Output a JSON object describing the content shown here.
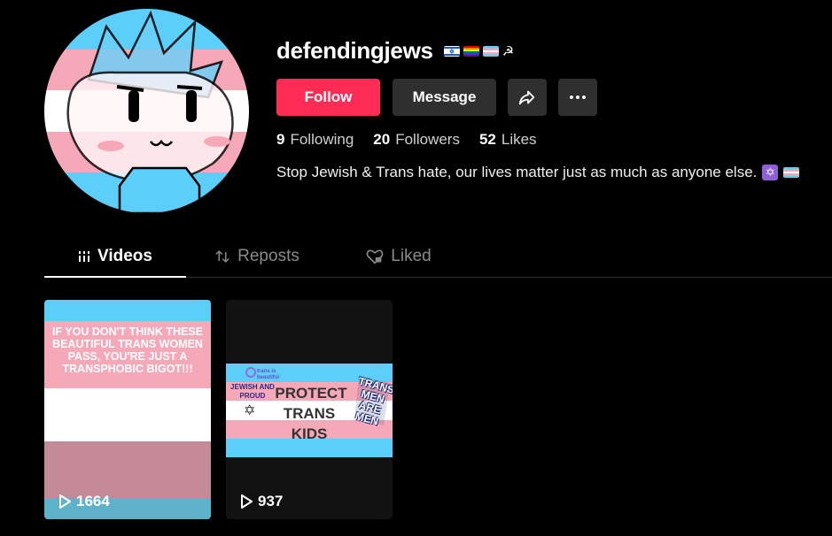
{
  "profile": {
    "username": "defendingjews",
    "flags": [
      "israel-flag-icon",
      "rainbow-flag-icon",
      "trans-flag-icon",
      "hammer-sickle-icon"
    ],
    "bio": "Stop Jewish & Trans hate, our lives matter just as much as anyone else.",
    "bio_icons": [
      "star-of-david-icon",
      "trans-flag-icon"
    ]
  },
  "actions": {
    "follow_label": "Follow",
    "message_label": "Message"
  },
  "stats": {
    "following_count": "9",
    "following_label": "Following",
    "followers_count": "20",
    "followers_label": "Followers",
    "likes_count": "52",
    "likes_label": "Likes"
  },
  "tabs": [
    {
      "label": "Videos",
      "active": true
    },
    {
      "label": "Reposts",
      "active": false
    },
    {
      "label": "Liked",
      "active": false
    }
  ],
  "videos": [
    {
      "overlay_text": "IF YOU DON'T THINK THESE BEAUTIFUL TRANS WOMEN PASS, YOU'RE JUST A TRANSPHOBIC BIGOT!!!",
      "views": "1664"
    },
    {
      "banner_text_1": "PROTECT",
      "banner_text_2": "TRANS",
      "banner_text_3": "KIDS",
      "sticker_left_small": "trans is beautiful",
      "sticker_left": "JEWISH AND PROUD",
      "sticker_right": "TRANS MEN ARE MEN",
      "views": "937"
    }
  ],
  "colors": {
    "trans_blue": "#5bcefa",
    "trans_pink": "#f5a9b8",
    "follow_red": "#fe2c55"
  }
}
